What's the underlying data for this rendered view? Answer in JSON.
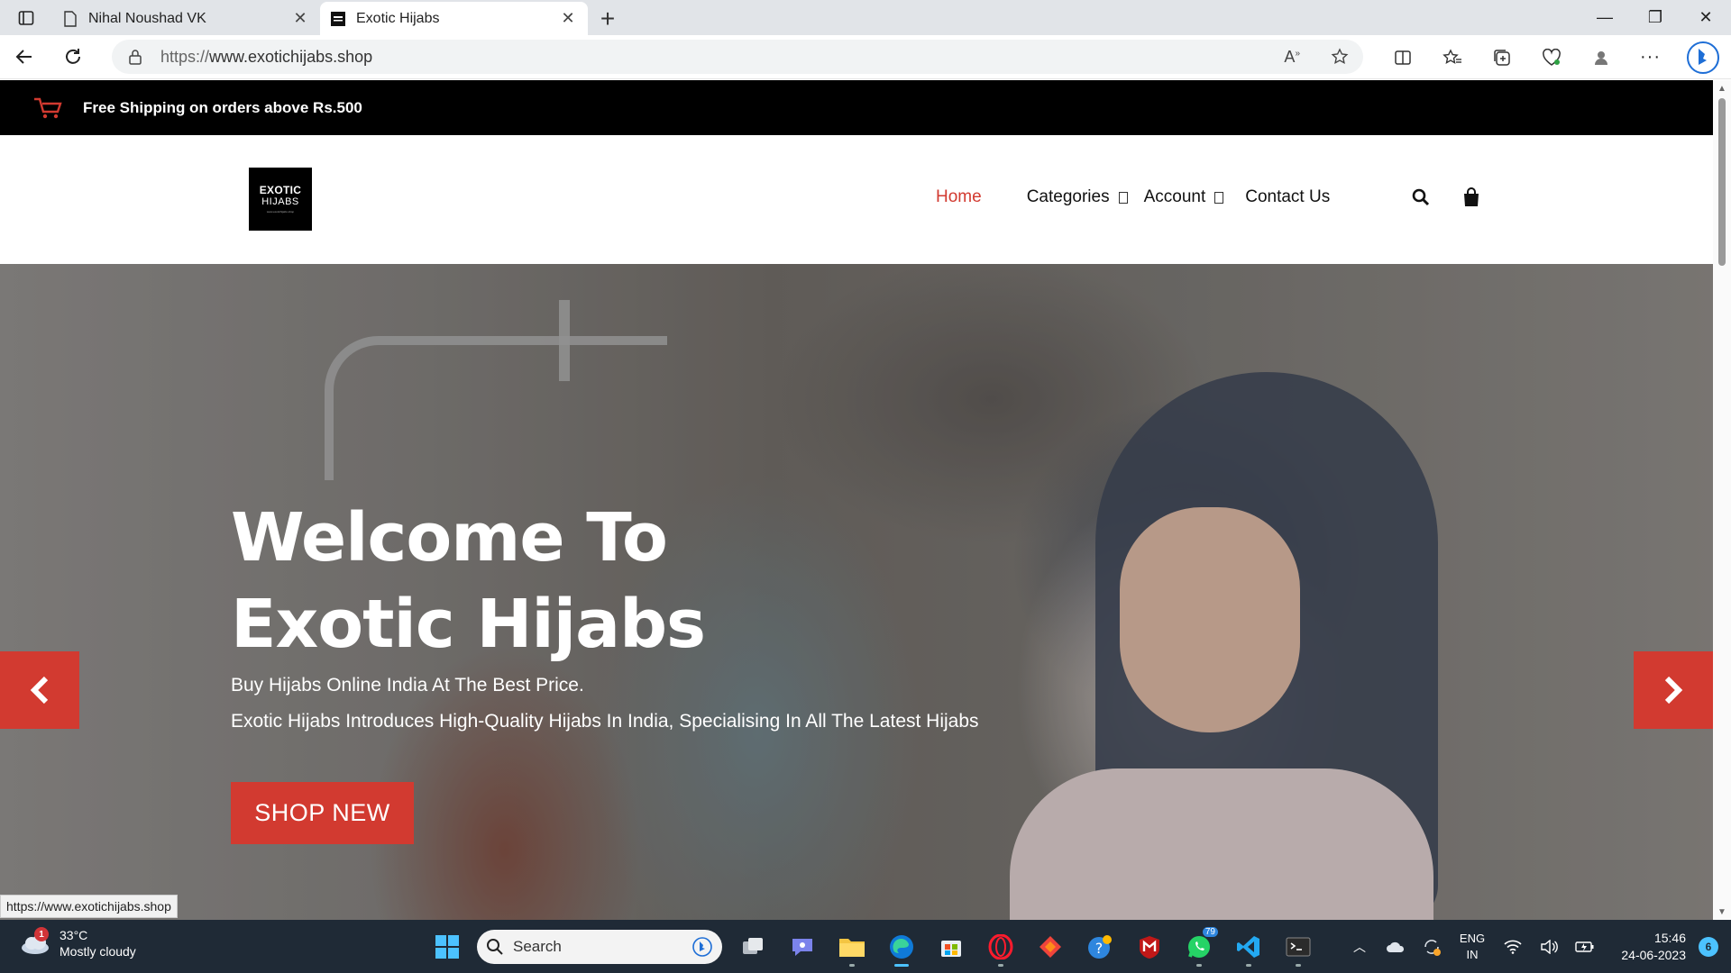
{
  "browser": {
    "tabs": [
      {
        "title": "Nihal Noushad VK",
        "active": false
      },
      {
        "title": "Exotic Hijabs",
        "active": true
      }
    ],
    "url_protocol": "https://",
    "url_host": "www.exotichijabs.shop",
    "status_url": "https://www.exotichijabs.shop"
  },
  "site": {
    "announcement": "Free Shipping on orders above Rs.500",
    "logo": {
      "line1": "EXOTIC",
      "line2": "HIJABS",
      "line3": "www.exotichijabs.shop"
    },
    "nav": {
      "home": "Home",
      "categories": "Categories",
      "account": "Account",
      "contact": "Contact Us"
    },
    "hero": {
      "title_line1": "Welcome To",
      "title_line2": "Exotic Hijabs",
      "subtitle1": "Buy Hijabs Online India At The Best Price.",
      "subtitle2": "Exotic Hijabs Introduces High-Quality Hijabs In India, Specialising In All The Latest Hijabs",
      "cta": "SHOP NEW"
    },
    "accent_color": "#d23a30"
  },
  "taskbar": {
    "weather": {
      "temp": "33°C",
      "condition": "Mostly cloudy",
      "alerts": "1"
    },
    "search_placeholder": "Search",
    "whatsapp_badge": "79",
    "lang_line1": "ENG",
    "lang_line2": "IN",
    "time": "15:46",
    "date": "24-06-2023",
    "notifications": "6"
  }
}
